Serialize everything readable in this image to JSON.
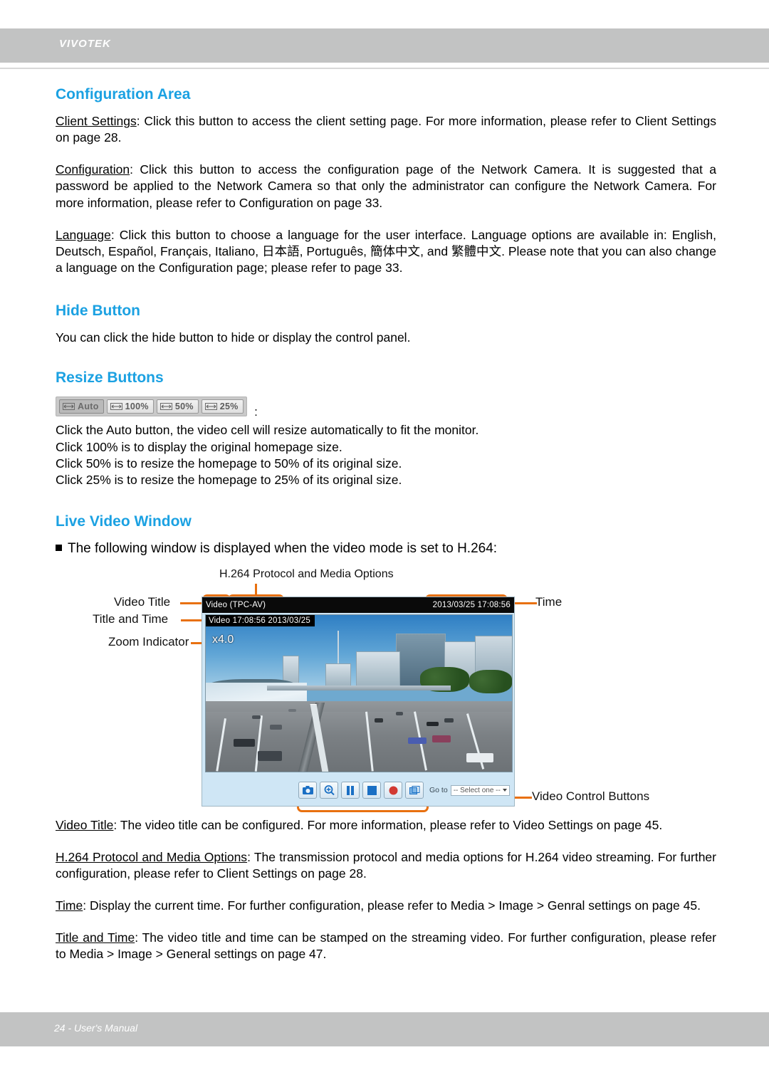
{
  "header": {
    "brand": "VIVOTEK"
  },
  "footer": {
    "page_label": "24 - User's Manual"
  },
  "sections": {
    "configuration_area": {
      "title": "Configuration Area",
      "para1_term": "Client Settings",
      "para1_rest": ": Click this button to access the client setting page. For more information, please refer to Client Settings on page 28.",
      "para2_term": "Configuration",
      "para2_rest": ": Click this button to access the configuration page of the Network Camera. It is suggested that a password be applied to the Network Camera so that only the administrator can configure the Network Camera. For more information, please refer to Configuration on page 33.",
      "para3_term": "Language",
      "para3_rest": ": Click this button to choose a language for the user interface. Language options are available in: English, Deutsch, Español, Français, Italiano, 日本語, Português, 簡体中文, and 繁體中文.  Please note that you can also change a language on the Configuration page; please refer to page 33."
    },
    "hide_button": {
      "title": "Hide Button",
      "text": "You can click the hide button to hide or display the control panel."
    },
    "resize_buttons": {
      "title": "Resize Buttons",
      "toolbar": {
        "auto": "Auto",
        "hundred": "100%",
        "fifty": "50%",
        "twentyfive": "25%",
        "trailing_colon": ":"
      },
      "line1": "Click the Auto button, the video cell will resize automatically to fit the monitor.",
      "line2": "Click 100% is to display the original homepage size.",
      "line3": "Click 50% is to resize the homepage to 50% of its original size.",
      "line4": "Click 25% is to resize the homepage to 25% of its original size."
    },
    "live_video_window": {
      "title": "Live Video Window",
      "bullet": "The following window is displayed when the video mode is set to H.264:",
      "para_video_title_term": "Video Title",
      "para_video_title_rest": ": The video title can be configured. For more information, please refer to Video Settings on page 45.",
      "para_h264_term": "H.264 Protocol and Media Options",
      "para_h264_rest": ": The transmission protocol and media options for H.264 video streaming. For further configuration, please refer to Client Settings on page 28.",
      "para_time_term": "Time",
      "para_time_rest": ": Display the current time. For further configuration, please refer to Media > Image > Genral settings on page 45.",
      "para_title_time_term": "Title and Time",
      "para_title_time_rest": ": The video title and time can be stamped on the streaming video. For further configuration, please refer to Media > Image > General settings on page 47."
    }
  },
  "figure": {
    "callouts": {
      "h264_protocol": "H.264 Protocol and Media Options",
      "video_title": "Video Title",
      "title_and_time": "Title and Time",
      "zoom_indicator": "Zoom Indicator",
      "time": "Time",
      "video_control_buttons": "Video Control Buttons"
    },
    "player": {
      "titlebar_left": "Video (TPC-AV)",
      "titlebar_right": "2013/03/25  17:08:56",
      "osd_title_time": "Video 17:08:56  2013/03/25",
      "osd_zoom": "x4.0",
      "goto_label": "Go to",
      "goto_value": "-- Select one --",
      "control_buttons": [
        "snapshot-icon",
        "digital-zoom-icon",
        "pause-icon",
        "stop-icon",
        "record-icon",
        "fullscreen-icon"
      ]
    }
  },
  "colors": {
    "heading_blue": "#1ba1e2",
    "bar_gray": "#c2c3c3",
    "callout_orange": "#e8700f",
    "player_bg": "#cfe6f5"
  }
}
